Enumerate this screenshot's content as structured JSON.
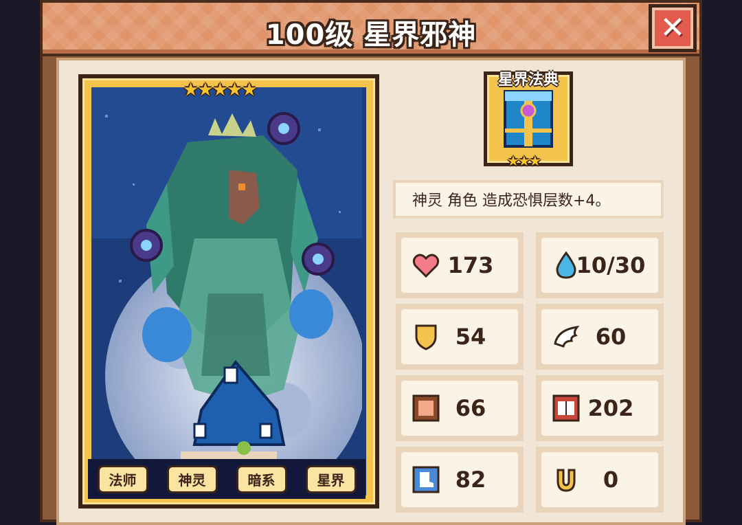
{
  "title": "100级 星界邪神",
  "card": {
    "stars": "★★★★★",
    "tags": [
      "法师",
      "神灵",
      "暗系",
      "星界"
    ]
  },
  "equipment": {
    "label": "星界法典",
    "stars": "★★★"
  },
  "description": "神灵 角色 造成恐惧层数+4。",
  "stats": [
    {
      "icon": "heart-icon",
      "value": "173"
    },
    {
      "icon": "water-drop-icon",
      "value": "10/30"
    },
    {
      "icon": "shield-icon",
      "value": "54"
    },
    {
      "icon": "wing-icon",
      "value": "60"
    },
    {
      "icon": "fist-icon",
      "value": "66"
    },
    {
      "icon": "book-icon",
      "value": "202"
    },
    {
      "icon": "boot-icon",
      "value": "82"
    },
    {
      "icon": "horseshoe-icon",
      "value": "0"
    }
  ],
  "colors": {
    "title_bar": "#e0946a",
    "panel": "#f1e6d6",
    "card_frame": "#f4c34c",
    "card_bg": "#1d3c7a",
    "close": "#e25b4c"
  }
}
